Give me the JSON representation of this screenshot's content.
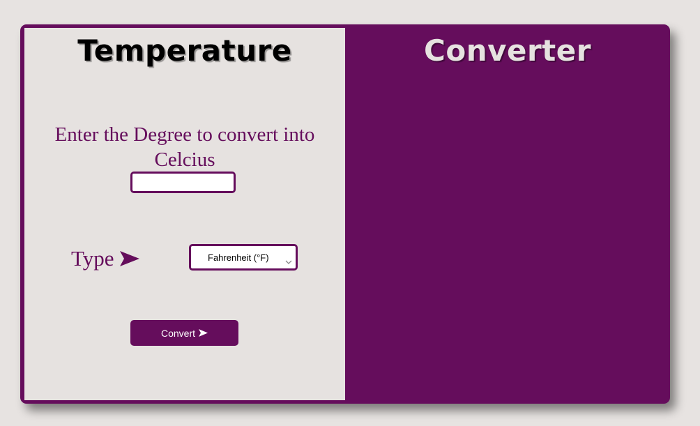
{
  "header": {
    "title_left": "Temperature",
    "title_right": "Converter"
  },
  "form": {
    "prompt": "Enter the Degree to convert into Celcius",
    "degree_input": {
      "value": "",
      "placeholder": ""
    },
    "type_label": "Type",
    "type_select": {
      "selected": "Fahrenheit (°F)"
    },
    "convert_button": {
      "label": "Convert"
    }
  },
  "icons": {
    "type_arrow": "arrow-right-icon",
    "convert_arrow": "arrow-right-icon",
    "select_chevron": "chevron-down-icon"
  },
  "colors": {
    "accent": "#650d5c",
    "panel": "#e6e2e0",
    "background": "#e7e3e1"
  }
}
